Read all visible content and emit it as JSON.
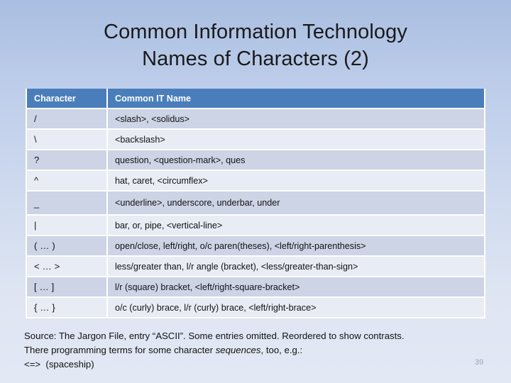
{
  "slide": {
    "title_lines": [
      "Common Information Technology",
      "Names of Characters (2)"
    ],
    "page_number": "39"
  },
  "table": {
    "headers": {
      "character": "Character",
      "common_it_name": "Common IT Name"
    },
    "rows": [
      {
        "character": "/",
        "name": "<slash>, <solidus>"
      },
      {
        "character": "\\",
        "name": "<backslash>"
      },
      {
        "character": "?",
        "name": "question, <question-mark>, ques"
      },
      {
        "character": "^",
        "name": "hat, caret, <circumflex>"
      },
      {
        "character": "_",
        "name": "<underline>, underscore, underbar, under"
      },
      {
        "character": "|",
        "name": "bar, or, pipe, <vertical-line>"
      },
      {
        "character": "( … )",
        "name": "open/close, left/right, o/c paren(theses), <left/right-parenthesis>"
      },
      {
        "character": "<  …  >",
        "name": "less/greater than, l/r angle (bracket), <less/greater-than-sign>"
      },
      {
        "character": "[  … ]",
        "name": "l/r (square) bracket, <left/right-square-bracket>"
      },
      {
        "character": "{ … }",
        "name": "o/c (curly) brace,  l/r (curly) brace, <left/right-brace>"
      }
    ]
  },
  "footer": {
    "line1": "Source: The Jargon File, entry “ASCII”. Some entries omitted. Reordered to show contrasts.",
    "line2_before": "There programming terms for some character ",
    "line2_italic": "sequences",
    "line2_after": ", too, e.g.:",
    "line3": "<=>  (spaceship)"
  },
  "colors": {
    "header_blue": "#4a7ebb",
    "band_a": "#ccd4e6",
    "band_b": "#e8ecf5",
    "bg_top": "#a9bee1",
    "bg_bottom": "#e2e8f4"
  }
}
